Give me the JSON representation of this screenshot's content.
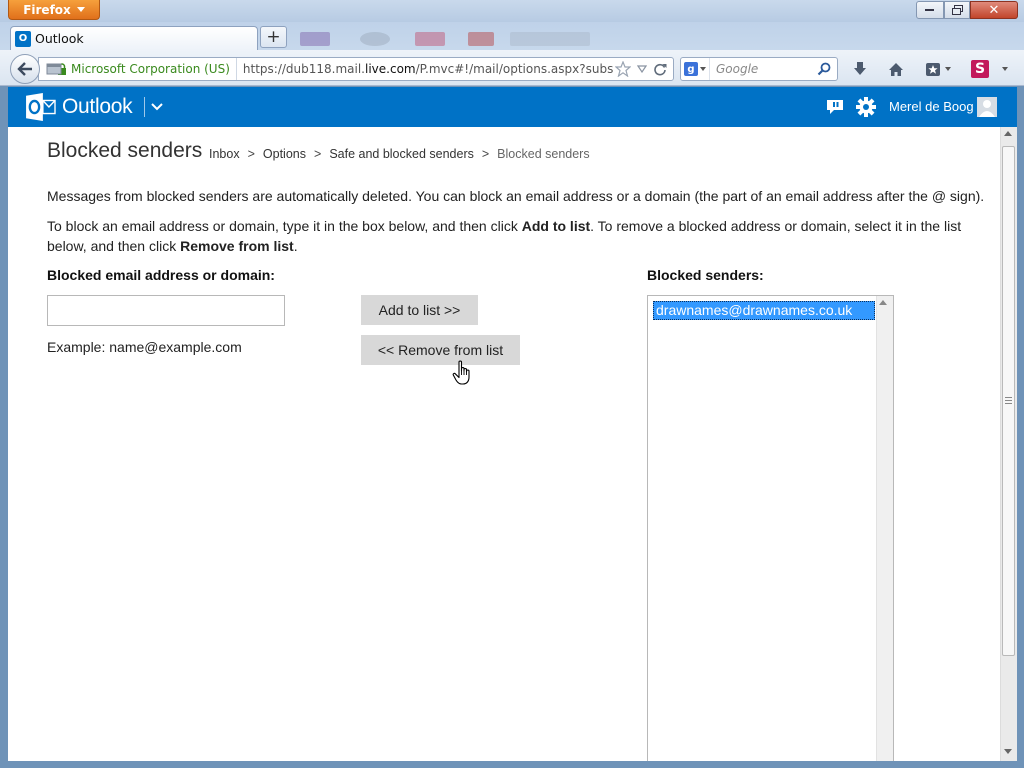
{
  "browser": {
    "app_button": "Firefox",
    "tab_title": "Outlook",
    "identity": "Microsoft Corporation (US)",
    "url_prefix": "https://dub118.mail.",
    "url_domain": "live.com",
    "url_suffix": "/P.mvc#!/mail/options.aspx?subsection=",
    "search_placeholder": "Google"
  },
  "header": {
    "app_name": "Outlook",
    "user_name": "Merel de Boog"
  },
  "page": {
    "title": "Blocked senders",
    "breadcrumb": [
      {
        "label": "Inbox"
      },
      {
        "label": "Options"
      },
      {
        "label": "Safe and blocked senders"
      }
    ],
    "breadcrumb_current": "Blocked senders",
    "breadcrumb_separator": ">",
    "intro": "Messages from blocked senders are automatically deleted. You can block an email address or a domain (the part of an email address after the @ sign).",
    "instructions": {
      "part1": "To block an email address or domain, type it in the box below, and then click ",
      "add_ref": "Add to list",
      "part2": ". To remove a blocked address or domain, select it in the list below, and then click ",
      "remove_ref": "Remove from list",
      "part3": "."
    },
    "input_label": "Blocked email address or domain:",
    "input_value": "",
    "input_placeholder": "",
    "example": "Example: name@example.com",
    "add_button": "Add to list >>",
    "remove_button": "<< Remove from list",
    "list_label": "Blocked senders:",
    "blocked_list": [
      "drawnames@drawnames.co.uk"
    ]
  },
  "colors": {
    "brand": "#0072c6",
    "selection": "#3399ff",
    "button_gray": "#d8d8d8"
  }
}
